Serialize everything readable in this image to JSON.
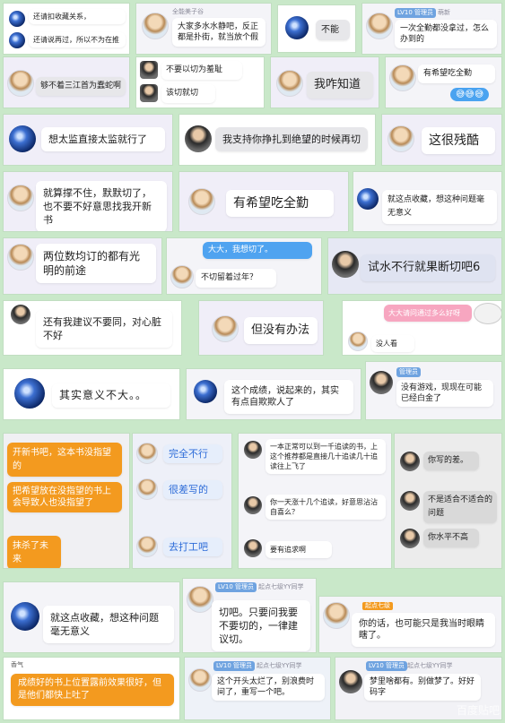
{
  "cards": [
    {
      "text": "还请扣收藏关系，",
      "text2": "还请说再过，所以不为在推"
    },
    {
      "name": "全能美子谷",
      "text": "大家多水水静吧，反正都是扑街，就当放个假"
    },
    {
      "text": "不能"
    },
    {
      "badge": "LV10 管理员",
      "name": "萌新",
      "text": "一次全勤都没拿过，怎么办到的"
    },
    {
      "text": "不要以切为羞耻",
      "text2": "该切就切"
    },
    {
      "text": "够不着三江首为蠢蛇啊"
    },
    {
      "text": "我咋知道"
    },
    {
      "text": "有希望吃全勤",
      "sticker": "😅😅😅"
    },
    {
      "text": "想太监直接太监就行了"
    },
    {
      "text": "我支持你挣扎到绝望的时候再切"
    },
    {
      "text": "这很残酷"
    },
    {
      "text": "就算撑不住，默默切了，也不要不好意思找我开新书"
    },
    {
      "text": "有希望吃全勤"
    },
    {
      "text": "就这点收藏，想这种问题毫无意义"
    },
    {
      "text": "两位数均订的都有光明的前途"
    },
    {
      "top": "大大，我想切了。",
      "text": "不切留着过年？"
    },
    {
      "text": "试水不行就果断切吧6"
    },
    {
      "text": "还有我建议不要同，对心脏不好"
    },
    {
      "text": "但没有办法"
    },
    {
      "top": "大大请问通过多么好呀",
      "text": "没人看"
    },
    {
      "text": "其实意义不大。。"
    },
    {
      "text": "这个成绩，说起来的，其实有点自欺欺人了"
    },
    {
      "badge": "管理员",
      "text": "没有游戏，现现在可能已经白金了"
    },
    {
      "text": "开新书吧，这本书没指望的"
    },
    {
      "text": "把希望放在没指望的书上会导致人也没指望了"
    },
    {
      "text": "抹杀了未来"
    },
    {
      "text": "完全不行"
    },
    {
      "text": "很差写的"
    },
    {
      "text": "去打工吧"
    },
    {
      "text": "一本正常可以到一千追读的书，上这个推荐都是直接几十追读几十追读往上飞了"
    },
    {
      "text": "你一天涨十几个追读，好意思沾沾自喜么？"
    },
    {
      "text": "要有追求啊"
    },
    {
      "text": "你写的差。"
    },
    {
      "text": "不是适合不适合的问题"
    },
    {
      "text": "你水平不高"
    },
    {
      "text": "就这点收藏，想这种问题毫无意义"
    },
    {
      "badge": "LV10 管理员",
      "name": "起点七级YY同学",
      "text": "切吧。只要问我要不要切的，一律建议切。"
    },
    {
      "name": "起点七级",
      "text": "你的话，也可能只是我当时眼睛瞎了。"
    },
    {
      "name": "香气",
      "text": "成绩好的书上位置露前效果很好，但是他们都快上吐了"
    },
    {
      "badge": "LV10 管理员",
      "name": "起点七级YY同学",
      "text": "这个开头太烂了，别浪费时间了，重写一个吧。"
    },
    {
      "badge": "LV10 管理员",
      "name": "起点七级YY同学",
      "text": "梦里啥都有。别做梦了。好好码字"
    }
  ],
  "watermark": "百度贴吧"
}
